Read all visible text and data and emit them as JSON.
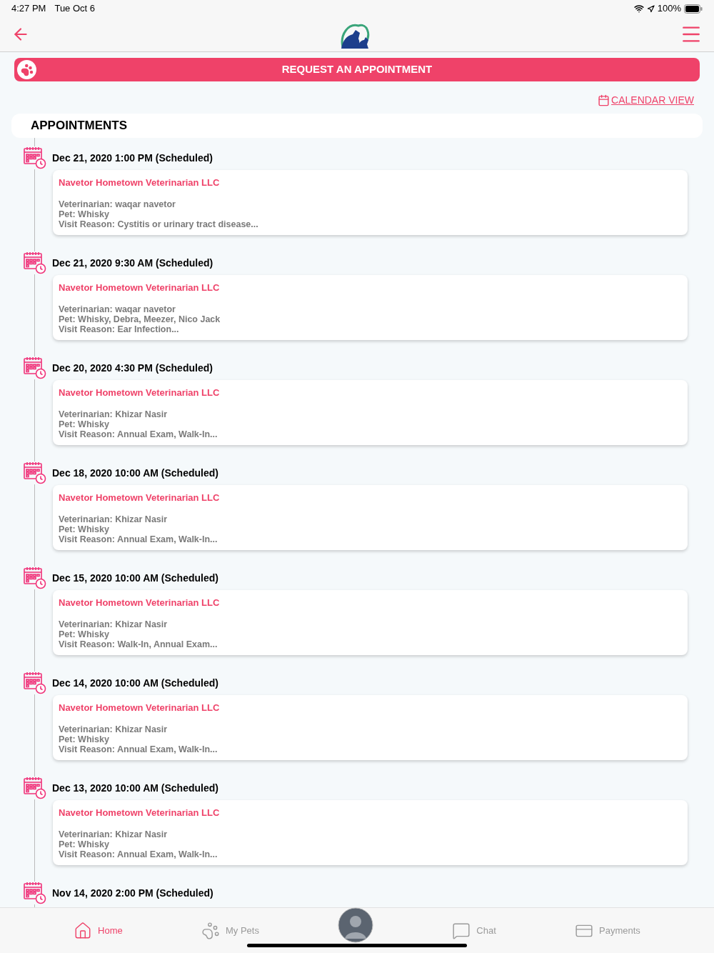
{
  "status_bar": {
    "time": "4:27 PM",
    "date": "Tue Oct 6",
    "battery": "100%"
  },
  "request_button": {
    "label": "REQUEST AN APPOINTMENT"
  },
  "calendar_link": {
    "label": "CALENDAR VIEW"
  },
  "appointments": {
    "title": "APPOINTMENTS",
    "items": [
      {
        "when": "Dec 21, 2020 1:00 PM (Scheduled)",
        "clinic": "Navetor Hometown Veterinarian LLC",
        "vet": "Veterinarian: waqar navetor",
        "pet": "Pet: Whisky",
        "reason": "Visit Reason: Cystitis or urinary tract disease..."
      },
      {
        "when": "Dec 21, 2020 9:30 AM (Scheduled)",
        "clinic": "Navetor Hometown Veterinarian LLC",
        "vet": "Veterinarian: waqar navetor",
        "pet": "Pet: Whisky, Debra, Meezer, Nico Jack",
        "reason": "Visit Reason: Ear Infection..."
      },
      {
        "when": "Dec 20, 2020 4:30 PM (Scheduled)",
        "clinic": "Navetor Hometown Veterinarian LLC",
        "vet": "Veterinarian: Khizar Nasir",
        "pet": "Pet: Whisky",
        "reason": "Visit Reason: Annual Exam, Walk-In..."
      },
      {
        "when": "Dec 18, 2020 10:00 AM (Scheduled)",
        "clinic": "Navetor Hometown Veterinarian LLC",
        "vet": "Veterinarian: Khizar Nasir",
        "pet": "Pet: Whisky",
        "reason": "Visit Reason: Annual Exam, Walk-In..."
      },
      {
        "when": "Dec 15, 2020 10:00 AM (Scheduled)",
        "clinic": "Navetor Hometown Veterinarian LLC",
        "vet": "Veterinarian: Khizar Nasir",
        "pet": "Pet: Whisky",
        "reason": "Visit Reason: Walk-In, Annual Exam..."
      },
      {
        "when": "Dec 14, 2020 10:00 AM (Scheduled)",
        "clinic": "Navetor Hometown Veterinarian LLC",
        "vet": "Veterinarian: Khizar Nasir",
        "pet": "Pet: Whisky",
        "reason": "Visit Reason: Annual Exam, Walk-In..."
      },
      {
        "when": "Dec 13, 2020 10:00 AM (Scheduled)",
        "clinic": "Navetor Hometown Veterinarian LLC",
        "vet": "Veterinarian: Khizar Nasir",
        "pet": "Pet: Whisky",
        "reason": "Visit Reason: Annual Exam, Walk-In..."
      },
      {
        "when": "Nov 14, 2020 2:00 PM (Scheduled)"
      }
    ]
  },
  "tab_bar": [
    {
      "kind": "home",
      "label": "Home",
      "selected": true
    },
    {
      "kind": "pets",
      "label": "My Pets",
      "selected": false
    },
    {
      "kind": "avatar",
      "selected": false
    },
    {
      "kind": "chat",
      "label": "Chat",
      "selected": false
    },
    {
      "kind": "payments",
      "label": "Payments",
      "selected": false
    }
  ]
}
